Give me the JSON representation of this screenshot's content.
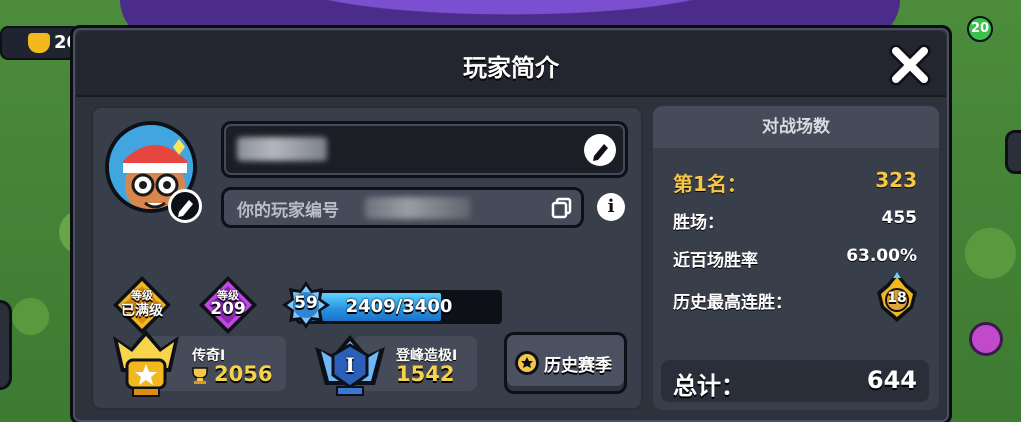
{
  "background": {
    "hud_trophy_count": "20",
    "notification_count": "20"
  },
  "modal": {
    "title": "玩家简介",
    "close_icon": "close-x-icon"
  },
  "profile": {
    "name_placeholder": "",
    "id_label": "你的玩家编号",
    "edit_icon": "pencil-icon",
    "copy_icon": "copy-icon",
    "info_icon": "info-icon",
    "info_glyph": "i"
  },
  "badges": {
    "level_max": {
      "top": "等级",
      "main": "已满级"
    },
    "level": {
      "top": "等级",
      "main": "209"
    },
    "xp_level": "59",
    "xp": {
      "current": 2409,
      "max": 3400,
      "text": "2409/3400",
      "fill_fraction": 0.708
    }
  },
  "ranks": {
    "legend": {
      "title": "传奇Ⅰ",
      "value": "2056"
    },
    "peak": {
      "title": "登峰造极Ⅰ",
      "value": "1542"
    },
    "history_button": "历史赛季",
    "peak_emblem_numeral": "I"
  },
  "stats": {
    "header": "对战场数",
    "first_place_label": "第1名：",
    "first_place_value": "323",
    "wins_label": "胜场：",
    "wins_value": "455",
    "winrate_label": "近百场胜率",
    "winrate_value": "63.00%",
    "best_streak_label": "历史最高连胜：",
    "best_streak_value": "18",
    "total_label": "总计：",
    "total_value": "644"
  },
  "colors": {
    "panel": "#393e4b",
    "modal_bg": "#2e323d",
    "gold": "#f4c64a",
    "xp_blue": "#2a95e3",
    "level_gold": "#f2b81e",
    "level_purple": "#b03ad8"
  }
}
